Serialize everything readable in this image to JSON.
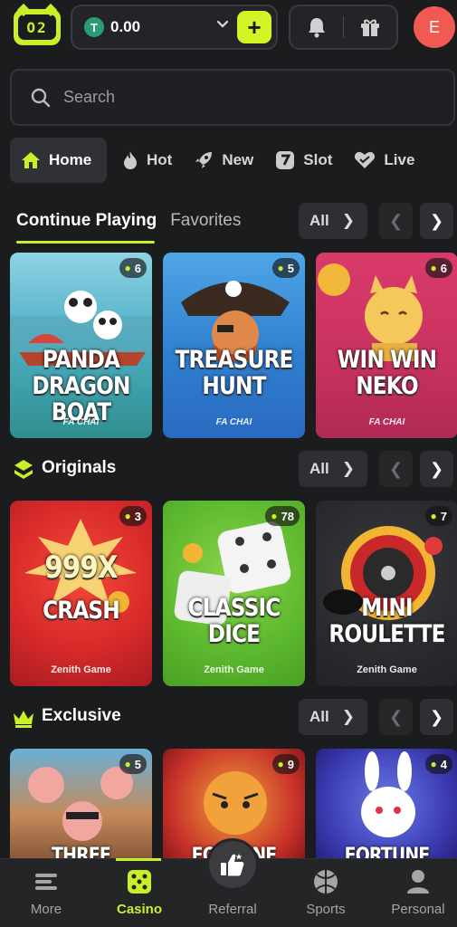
{
  "header": {
    "logo_text": "O2",
    "balance": "0.00",
    "currency_symbol": "T",
    "add_label": "+",
    "avatar_initial": "E",
    "accent": "#d4f427"
  },
  "search": {
    "placeholder": "Search"
  },
  "categories": [
    {
      "label": "Home",
      "icon": "home-icon",
      "active": true
    },
    {
      "label": "Hot",
      "icon": "flame-icon"
    },
    {
      "label": "New",
      "icon": "rocket-icon"
    },
    {
      "label": "Slot",
      "icon": "slot-icon"
    },
    {
      "label": "Live",
      "icon": "heart-icon"
    }
  ],
  "sections": {
    "continue": {
      "tabs": [
        "Continue Playing",
        "Favorites"
      ],
      "all_label": "All",
      "games": [
        {
          "title": "PANDA DRAGON BOAT",
          "line1": "PANDA",
          "line2": "DRAGON BOAT",
          "provider": "FA CHAI",
          "players": "6"
        },
        {
          "title": "TREASURE HUNT",
          "line1": "TREASURE",
          "line2": "HUNT",
          "provider": "FA CHAI",
          "players": "5"
        },
        {
          "title": "WIN WIN NEKO",
          "line1": "WIN WIN",
          "line2": "NEKO",
          "provider": "FA CHAI",
          "players": "6"
        }
      ]
    },
    "originals": {
      "title": "Originals",
      "all_label": "All",
      "games": [
        {
          "line1": "999X",
          "line2": "CRASH",
          "provider": "Zenith Game",
          "players": "3"
        },
        {
          "line1": "CLASSIC",
          "line2": "DICE",
          "provider": "Zenith Game",
          "players": "78"
        },
        {
          "line1": "MINI",
          "line2": "ROULETTE",
          "provider": "Zenith Game",
          "players": "7"
        }
      ]
    },
    "exclusive": {
      "title": "Exclusive",
      "all_label": "All",
      "games": [
        {
          "line1": "THREE CRAZY",
          "players": "5"
        },
        {
          "line1": "FORTUNE",
          "players": "9"
        },
        {
          "line1": "FORTUNE",
          "players": "4"
        }
      ]
    }
  },
  "bottom_nav": [
    {
      "label": "More",
      "icon": "menu-icon"
    },
    {
      "label": "Casino",
      "icon": "dice-icon",
      "active": true
    },
    {
      "label": "Referral",
      "icon": "thumbs-up-icon"
    },
    {
      "label": "Sports",
      "icon": "ball-icon"
    },
    {
      "label": "Personal",
      "icon": "user-icon"
    }
  ]
}
